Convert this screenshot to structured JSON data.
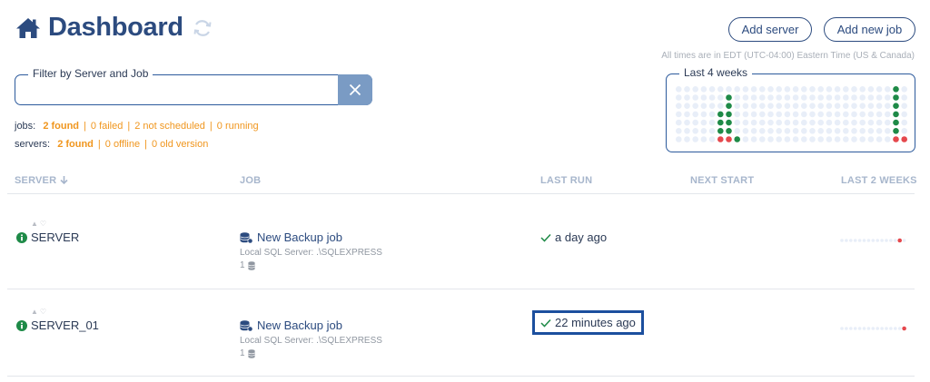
{
  "header": {
    "title": "Dashboard",
    "add_server_label": "Add server",
    "add_job_label": "Add new job",
    "timezone_note": "All times are in EDT (UTC-04:00) Eastern Time (US & Canada)"
  },
  "filter": {
    "legend": "Filter by Server and Job",
    "value": "",
    "placeholder": ""
  },
  "stats": {
    "jobs_label": "jobs:",
    "jobs_found": "2 found",
    "jobs_failed": "0 failed",
    "jobs_not_scheduled": "2 not scheduled",
    "jobs_running": "0 running",
    "servers_label": "servers:",
    "servers_found": "2 found",
    "servers_offline": "0 offline",
    "servers_old": "0 old version"
  },
  "weeks": {
    "legend": "Last 4 weeks",
    "columns": 28,
    "rows": 7,
    "colors": {
      "empty": "#e8eef8",
      "success": "#1e8a47",
      "failed": "#e5484d"
    },
    "cells": [
      {
        "col": 6,
        "row": 1,
        "status": "success"
      },
      {
        "col": 6,
        "row": 2,
        "status": "success"
      },
      {
        "col": 6,
        "row": 3,
        "status": "success"
      },
      {
        "col": 6,
        "row": 4,
        "status": "success"
      },
      {
        "col": 6,
        "row": 5,
        "status": "success"
      },
      {
        "col": 6,
        "row": 6,
        "status": "failed"
      },
      {
        "col": 5,
        "row": 3,
        "status": "success"
      },
      {
        "col": 5,
        "row": 4,
        "status": "success"
      },
      {
        "col": 5,
        "row": 5,
        "status": "success"
      },
      {
        "col": 5,
        "row": 6,
        "status": "failed"
      },
      {
        "col": 7,
        "row": 6,
        "status": "success"
      },
      {
        "col": 26,
        "row": 0,
        "status": "success"
      },
      {
        "col": 26,
        "row": 1,
        "status": "success"
      },
      {
        "col": 26,
        "row": 2,
        "status": "success"
      },
      {
        "col": 26,
        "row": 3,
        "status": "success"
      },
      {
        "col": 26,
        "row": 4,
        "status": "success"
      },
      {
        "col": 26,
        "row": 5,
        "status": "success"
      },
      {
        "col": 26,
        "row": 6,
        "status": "failed"
      },
      {
        "col": 27,
        "row": 6,
        "status": "failed"
      }
    ]
  },
  "table": {
    "columns": {
      "server": "SERVER",
      "job": "JOB",
      "last_run": "LAST RUN",
      "next_start": "NEXT START",
      "last_2_weeks": "LAST 2 WEEKS"
    },
    "rows": [
      {
        "server": "SERVER",
        "job": "New Backup job",
        "job_sub": "Local SQL Server: .\\SQLEXPRESS",
        "db_count": "1",
        "last_run": "a day ago",
        "next_start": "",
        "highlighted": false,
        "spark_failed_index": 13
      },
      {
        "server": "SERVER_01",
        "job": "New Backup job",
        "job_sub": "Local SQL Server: .\\SQLEXPRESS",
        "db_count": "1",
        "last_run": "22 minutes ago",
        "next_start": "",
        "highlighted": true,
        "spark_failed_index": 14
      }
    ],
    "spark_length": 15
  }
}
